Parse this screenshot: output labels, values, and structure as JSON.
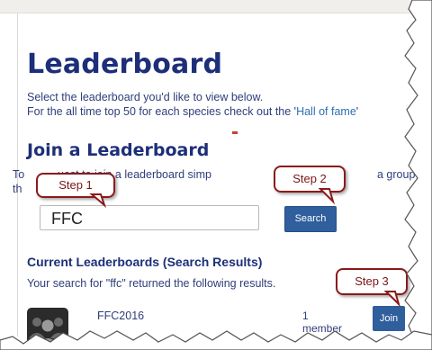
{
  "page": {
    "title": "Leaderboard",
    "intro_line1": "Select the leaderboard you'd like to view below.",
    "intro_line2_prefix": "For the all time top 50 for each species check out the '",
    "intro_link": "Hall of fame",
    "intro_line2_suffix": "'"
  },
  "join": {
    "heading": "Join a Leaderboard",
    "text_part1": "To",
    "text_part2": "uest to join a leaderboard simp",
    "text_part3": "a group using",
    "text_line2": "th",
    "search_value": "FFC",
    "search_button": "Search"
  },
  "results": {
    "heading": "Current Leaderboards (Search Results)",
    "summary": "Your search for \"ffc\" returned the following results.",
    "items": [
      {
        "name": "FFC2016",
        "members_count": "1",
        "members_label": "member",
        "join_label": "Join"
      }
    ]
  },
  "callouts": {
    "step1": "Step 1",
    "step2": "Step 2",
    "step3": "Step 3",
    "accent": "#8b1a1a"
  },
  "colors": {
    "heading": "#1d2f78",
    "button": "#2f5f9c",
    "link": "#2c6fb3"
  }
}
